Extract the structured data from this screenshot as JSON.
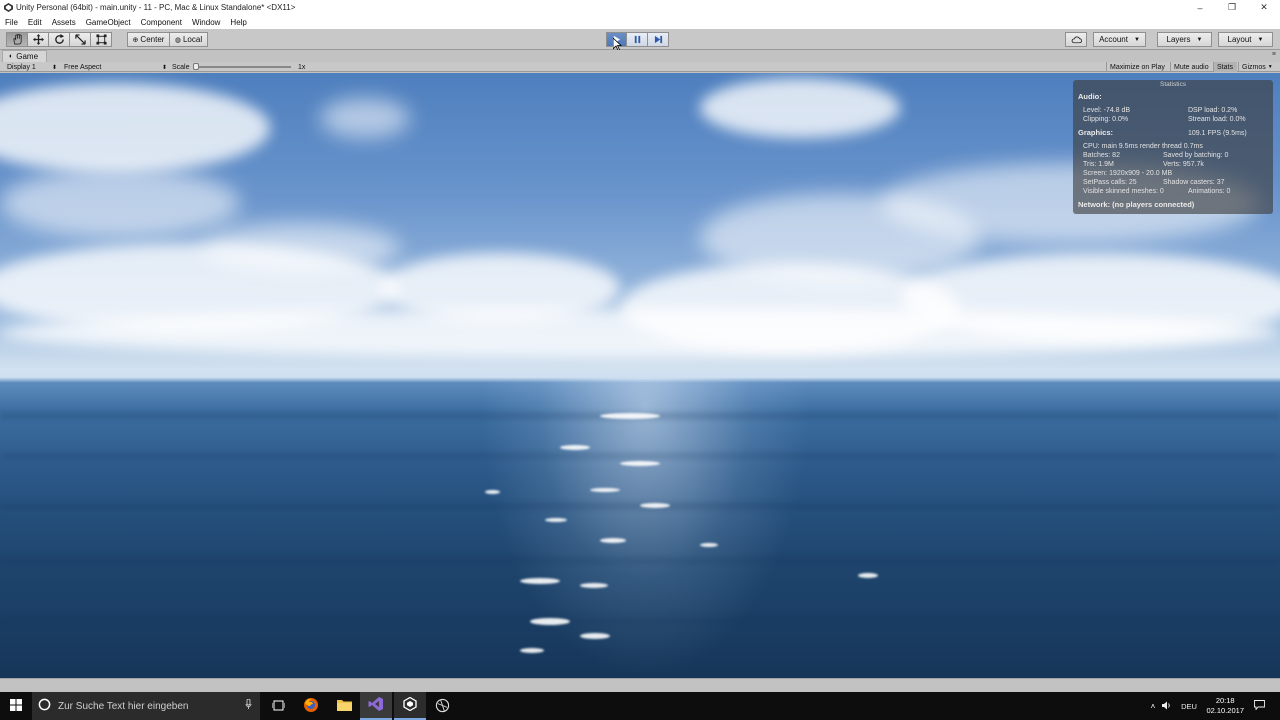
{
  "window": {
    "title": "Unity Personal (64bit) - main.unity - 11 - PC, Mac & Linux Standalone* <DX11>",
    "controls": {
      "minimize": "–",
      "maximize": "❐",
      "close": "✕"
    }
  },
  "menu": [
    "File",
    "Edit",
    "Assets",
    "GameObject",
    "Component",
    "Window",
    "Help"
  ],
  "toolbar": {
    "pivot_label": "Center",
    "space_label": "Local",
    "account_label": "Account",
    "layers_label": "Layers",
    "layout_label": "Layout"
  },
  "game_view": {
    "tab_label": "Game",
    "display_label": "Display 1",
    "aspect_label": "Free Aspect",
    "scale_label": "Scale",
    "scale_value": "1x",
    "maximize_on_play": "Maximize on Play",
    "mute_audio": "Mute audio",
    "stats": "Stats",
    "gizmos": "Gizmos"
  },
  "statistics": {
    "title": "Statistics",
    "audio_header": "Audio:",
    "level": "Level: -74.8 dB",
    "clipping": "Clipping: 0.0%",
    "dsp_load": "DSP load: 0.2%",
    "stream_load": "Stream load: 0.0%",
    "graphics_header": "Graphics:",
    "fps": "109.1 FPS (9.5ms)",
    "cpu": "CPU: main 9.5ms  render thread 0.7ms",
    "batches": "Batches: 82",
    "saved_batching": "Saved by batching: 0",
    "tris": "Tris: 1.9M",
    "verts": "Verts: 957.7k",
    "screen": "Screen: 1920x909 - 20.0 MB",
    "setpass": "SetPass calls: 25",
    "shadow_casters": "Shadow casters: 37",
    "skinned": "Visible skinned meshes: 0",
    "animations": "Animations: 0",
    "network": "Network: (no players connected)"
  },
  "taskbar": {
    "search_placeholder": "Zur Suche Text hier eingeben",
    "language": "DEU",
    "time": "20:18",
    "date": "02.10.2017"
  }
}
